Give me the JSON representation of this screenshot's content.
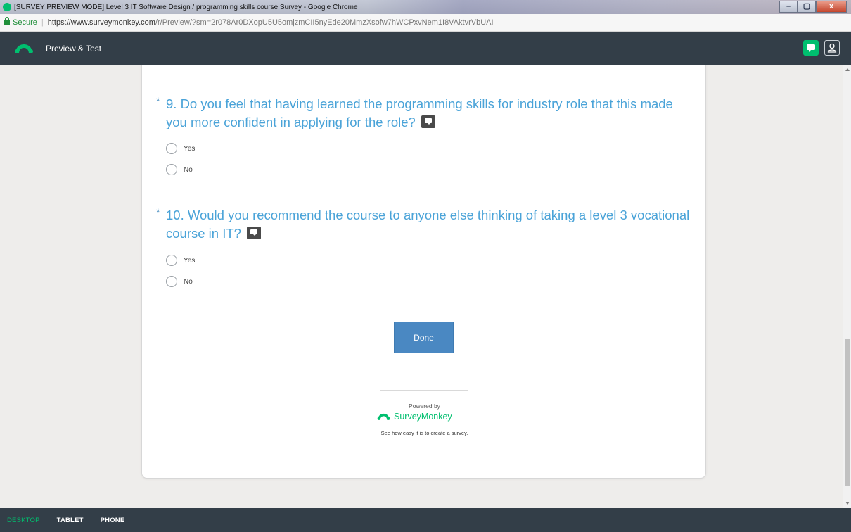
{
  "window": {
    "title": "[SURVEY PREVIEW MODE] Level 3 IT Software Design / programming skills course Survey - Google Chrome",
    "controls": [
      "–",
      "▢",
      "x"
    ]
  },
  "address": {
    "secure_label": "Secure",
    "url_prefix": "https://www.surveymonkey.com",
    "url_rest": "/r/Preview/?sm=2r078Ar0DXopU5U5omjzmCII5nyEde20MmzXsofw7hWCPxvNem1I8VAktvrVbUAI"
  },
  "appbar": {
    "title": "Preview & Test"
  },
  "survey": {
    "partial_option": "No",
    "questions": [
      {
        "star": "*",
        "text": "9. Do you feel that having learned the programming skills for industry role that this made you more confident in applying for the role?",
        "options": [
          "Yes",
          "No"
        ]
      },
      {
        "star": "*",
        "text": "10. Would you recommend the course to anyone else thinking of taking a level 3 vocational course in IT?",
        "options": [
          "Yes",
          "No"
        ]
      }
    ],
    "done_label": "Done"
  },
  "footer": {
    "powered_by": "Powered by",
    "brand": "SurveyMonkey",
    "tagline_prefix": "See how easy it is to",
    "tagline_link": "create a survey",
    "tagline_suffix": "."
  },
  "devices": {
    "items": [
      "DESKTOP",
      "TABLET",
      "PHONE"
    ],
    "active": "DESKTOP"
  },
  "colors": {
    "accent_green": "#00bf6f",
    "question_blue": "#4aa3d8",
    "button_blue": "#4a88c2",
    "bar_dark": "#333e48"
  },
  "icons": {
    "tab_favicon": "surveymonkey-favicon-icon",
    "lock": "lock-icon",
    "brand": "surveymonkey-logo-icon",
    "feedback": "comment-icon",
    "user": "user-icon",
    "question_comment": "comment-icon"
  }
}
